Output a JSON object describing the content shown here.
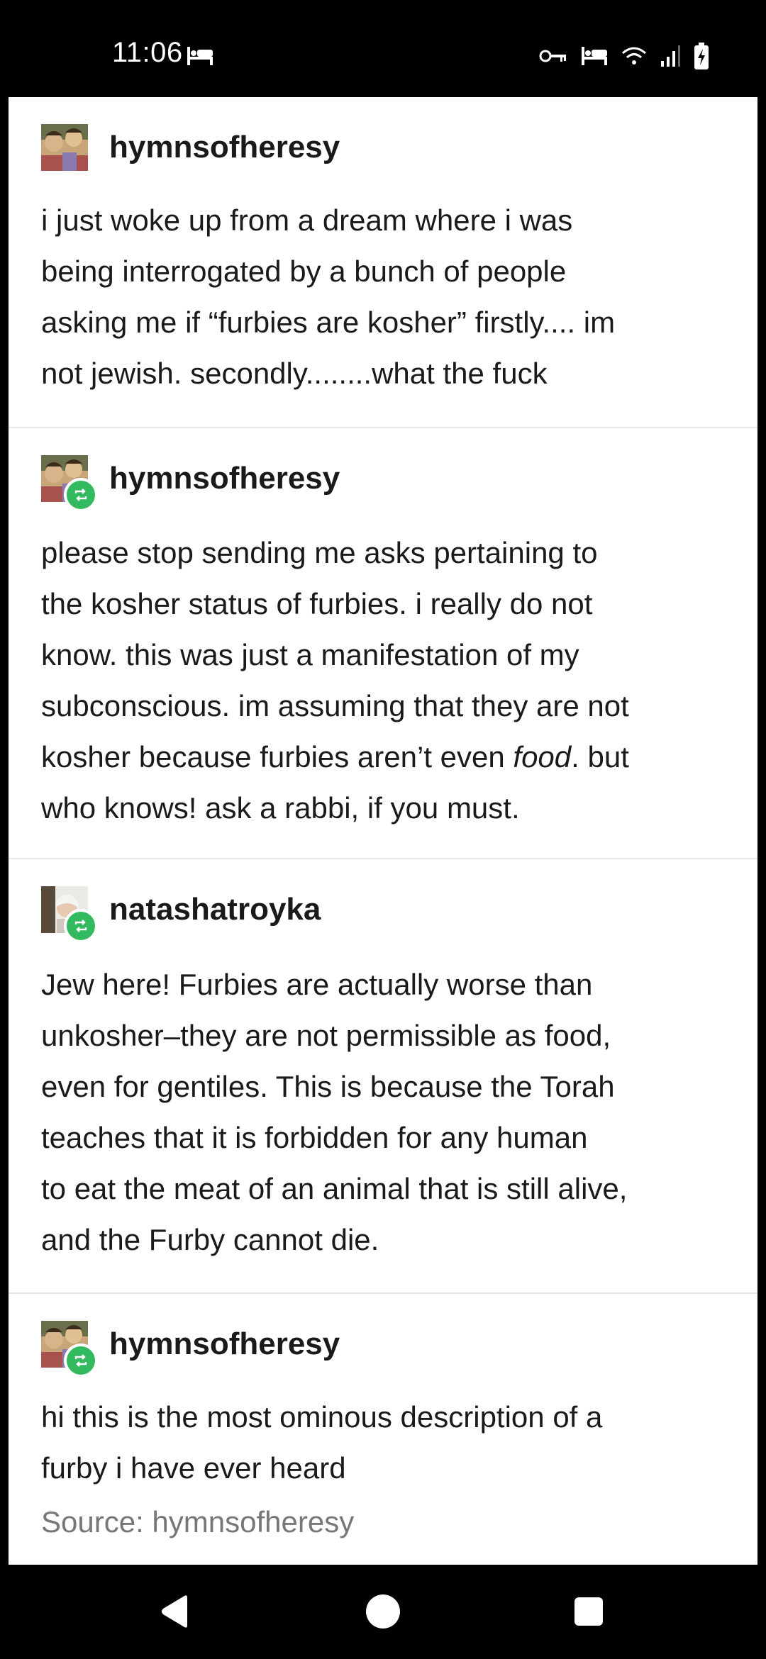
{
  "status_bar": {
    "time": "11:06",
    "left_icons": [
      "bed-icon"
    ],
    "right_icons": [
      "key-icon",
      "bed-icon",
      "wifi-icon",
      "signal-icon",
      "battery-charging-icon"
    ]
  },
  "posts": [
    {
      "username": "hymnsofheresy",
      "reblog": false,
      "text": "i just woke up from a dream where i was\nbeing interrogated by a bunch of people\nasking me if “furbies are kosher” firstly.... im\nnot jewish. secondly........what the fuck"
    },
    {
      "username": "hymnsofheresy",
      "reblog": true,
      "text_line1": "please stop sending me asks pertaining to",
      "text_line2": "the kosher status of furbies. i really do not",
      "text_line3": "know. this was just a manifestation of my",
      "text_line4": "subconscious. im assuming that they are not",
      "text_line5_pre": "kosher because furbies aren’t even ",
      "text_line5_em": "food",
      "text_line5_post": ". but",
      "text_line6": "who knows! ask a rabbi, if you must."
    },
    {
      "username": "natashatroyka",
      "reblog": true,
      "text": "Jew here! Furbies are actually worse than\nunkosher–they are not permissible as food,\neven for gentiles. This is because the Torah\nteaches that it is forbidden for any human\nto eat the meat of an animal that is still alive,\nand the Furby cannot die."
    },
    {
      "username": "hymnsofheresy",
      "reblog": true,
      "text": "hi this is the most ominous description of a\nfurby i have ever heard"
    }
  ],
  "source": "Source: hymnsofheresy",
  "colors": {
    "reblog_badge": "#33b95e",
    "text": "#1a1a1a",
    "source_text": "#777777",
    "divider": "#e6e6e6"
  },
  "nav_bar": {
    "buttons": [
      "back-icon",
      "home-icon",
      "recents-icon"
    ]
  }
}
